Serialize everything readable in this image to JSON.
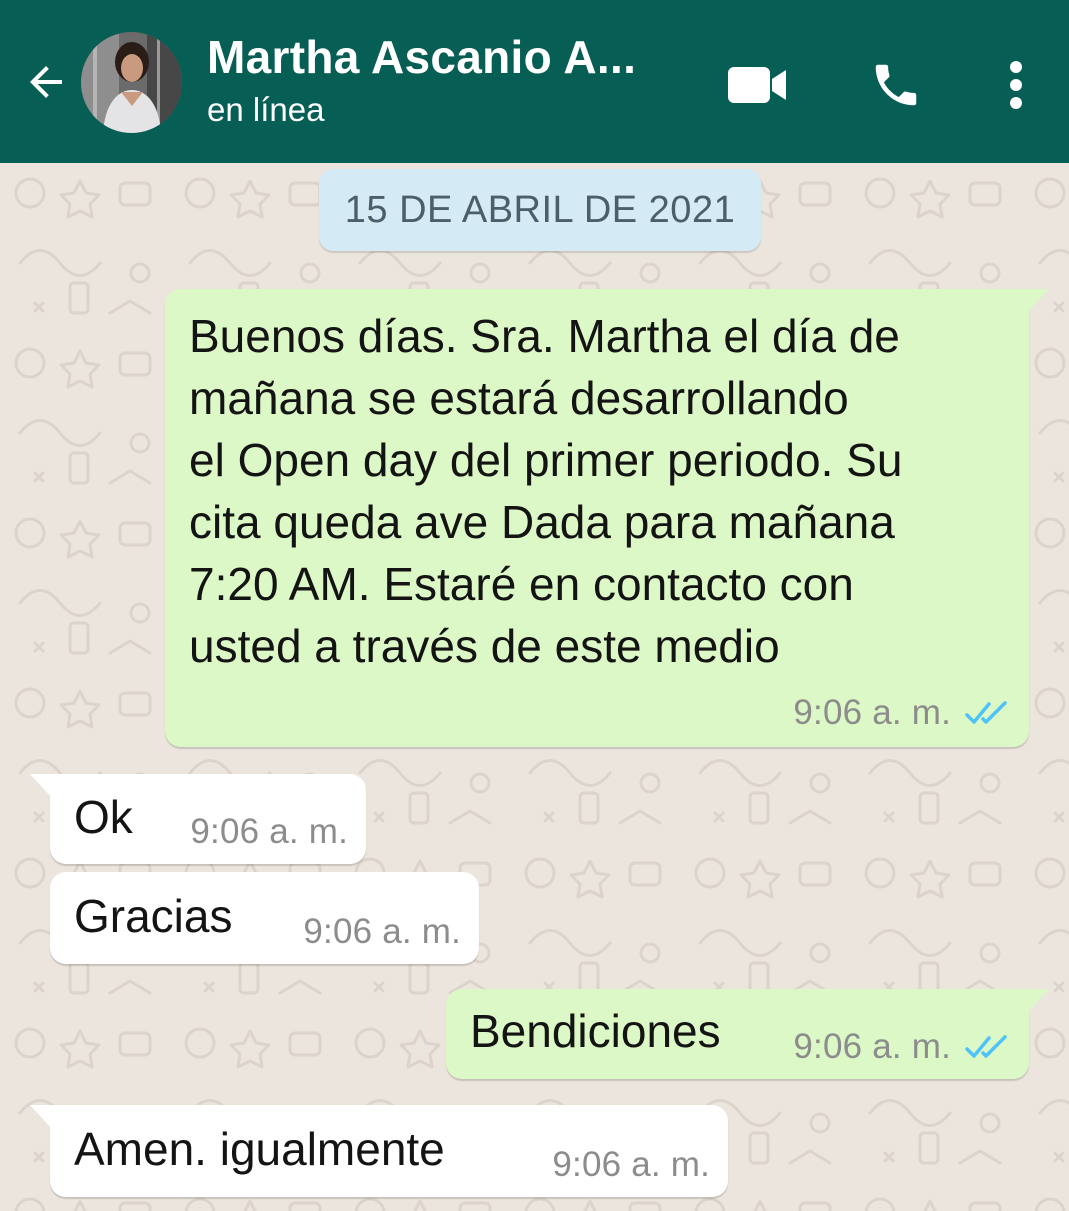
{
  "header": {
    "contact_name": "Martha Ascanio A...",
    "status": "en línea",
    "back_icon": "arrow-left-icon",
    "video_icon": "video-camera-icon",
    "call_icon": "phone-icon",
    "menu_icon": "more-vertical-icon",
    "background_color": "#075e54"
  },
  "chat": {
    "date_separator": "15 DE ABRIL DE 2021",
    "messages": [
      {
        "direction": "outgoing",
        "lines": [
          "Buenos días. Sra. Martha el día de",
          "mañana se estará desarrollando",
          "el Open day del primer periodo. Su",
          "cita queda ave Dada para mañana",
          "7:20 AM. Estaré en contacto con",
          "usted a través de este medio"
        ],
        "time": "9:06 a. m.",
        "status_icon": "double-check-read-icon"
      },
      {
        "direction": "incoming",
        "text": "Ok",
        "time": "9:06 a. m."
      },
      {
        "direction": "incoming",
        "text": "Gracias",
        "time": "9:06 a. m."
      },
      {
        "direction": "outgoing",
        "text": "Bendiciones",
        "time": "9:06 a. m.",
        "status_icon": "double-check-read-icon"
      },
      {
        "direction": "incoming",
        "text": "Amen. igualmente",
        "time": "9:06 a. m."
      }
    ],
    "colors": {
      "outgoing_bubble": "#dcf8c6",
      "incoming_bubble": "#ffffff",
      "date_chip": "#d4eaf4",
      "read_ticks": "#4fc3f7",
      "wallpaper": "#ece5dd"
    }
  }
}
